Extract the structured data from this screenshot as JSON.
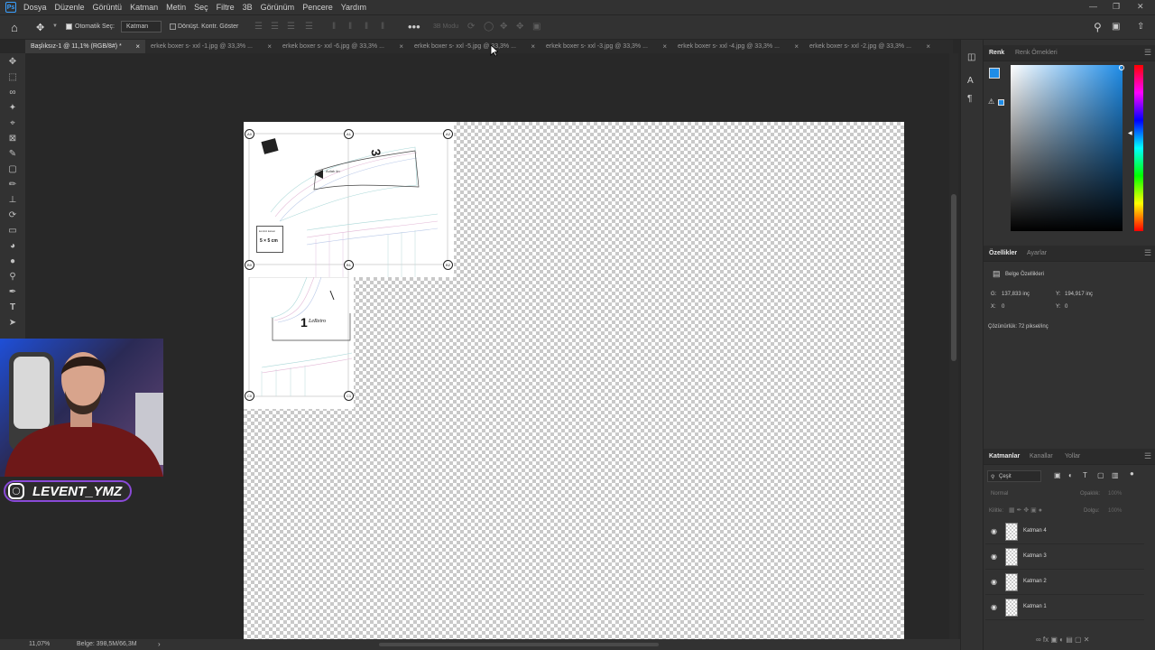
{
  "app": {
    "logo": "Ps"
  },
  "menu": [
    "Dosya",
    "Düzenle",
    "Görüntü",
    "Katman",
    "Metin",
    "Seç",
    "Filtre",
    "3B",
    "Görünüm",
    "Pencere",
    "Yardım"
  ],
  "options": {
    "auto_select_label": "Otomatik Seç:",
    "auto_select_value": "Katman",
    "transform_label": "Dönüşt. Kontr. Göster",
    "mode_3d": "3B Modu"
  },
  "tabs": [
    {
      "label": "Başlıksız-1 @ 11,1% (RGB/8#) *",
      "active": true
    },
    {
      "label": "erkek boxer s- xxl -1.jpg @ 33,3% ...",
      "active": false
    },
    {
      "label": "erkek boxer s- xxl -6.jpg @ 33,3% ...",
      "active": false
    },
    {
      "label": "erkek boxer s- xxl -5.jpg @ 33,3% ...",
      "active": false
    },
    {
      "label": "erkek boxer s- xxl -3.jpg @ 33,3% ...",
      "active": false
    },
    {
      "label": "erkek boxer s- xxl -4.jpg @ 33,3% ...",
      "active": false
    },
    {
      "label": "erkek boxer s- xxl -2.jpg @ 33,3% ...",
      "active": false
    }
  ],
  "pattern": {
    "marks": [
      "A0",
      "A1",
      "A2",
      "B0",
      "B1",
      "B2",
      "C0",
      "C1"
    ],
    "size_box": "5 × 5 cm",
    "size_caption": "kontrol karesi",
    "piece_number_top": "3",
    "piece_number_bottom": "1",
    "brand": "LeRetro",
    "label_small": "Aulak ön"
  },
  "status": {
    "zoom": "11,07%",
    "doc": "Belge: 398,5M/66,3M"
  },
  "color_panel": {
    "tabs": [
      "Renk",
      "Renk Örnekleri"
    ],
    "fg_color": "#1f8de8",
    "bg_color": "#ffffff"
  },
  "properties": {
    "tabs": [
      "Özellikler",
      "Ayarlar"
    ],
    "header": "Belge Özellikleri",
    "w_label": "G:",
    "w_value": "137,833 inç",
    "h_label": "Y:",
    "h_value": "194,917 inç",
    "x_label": "X:",
    "x_value": "0",
    "y_label": "Y:",
    "y_value": "0",
    "resolution": "Çözünürlük: 72 piksel/inç"
  },
  "layers_panel": {
    "tabs": [
      "Katmanlar",
      "Kanallar",
      "Yollar"
    ],
    "filter_label": "Çeşit",
    "blend_mode": "Normal",
    "opacity_label": "Opaklık:",
    "opacity_value": "100%",
    "lock_label": "Kilitle:",
    "fill_label": "Dolgu:",
    "fill_value": "100%",
    "layers": [
      "Katman 4",
      "Katman 3",
      "Katman 2",
      "Katman 1"
    ]
  },
  "webcam": {
    "handle": "LEVENT_YMZ"
  }
}
